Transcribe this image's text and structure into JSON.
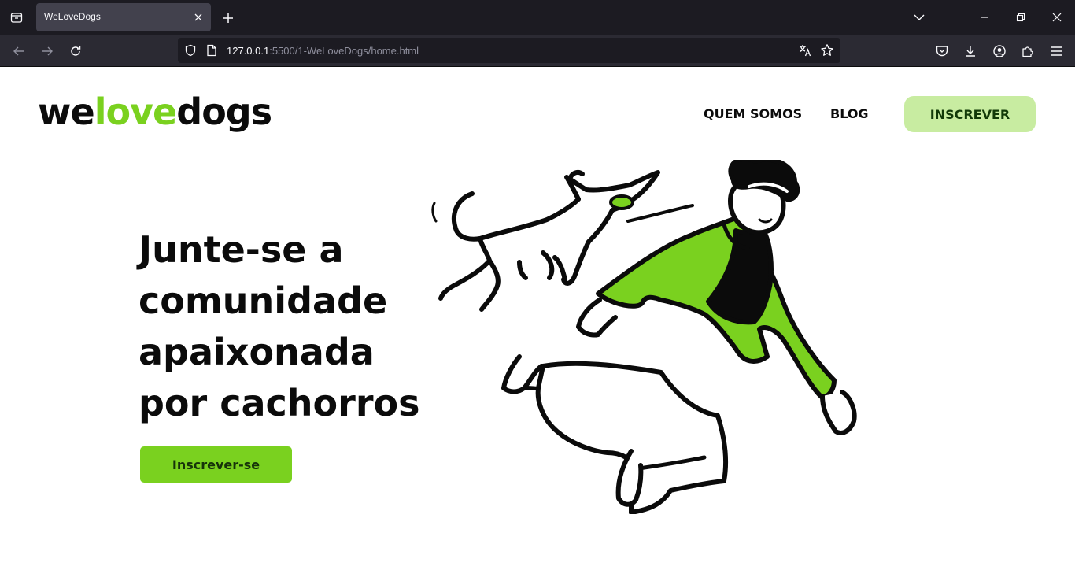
{
  "browser": {
    "tab_title": "WeLoveDogs",
    "url_host": "127.0.0.1",
    "url_rest": ":5500/1-WeLoveDogs/home.html"
  },
  "site": {
    "logo": {
      "part1": "we",
      "part2": "love",
      "part3": "dogs"
    },
    "nav": [
      {
        "label": "QUEM SOMOS"
      },
      {
        "label": "BLOG"
      }
    ],
    "signup_top_label": "INSCREVER",
    "hero": {
      "lines": [
        "Junte-se a",
        "comunidade",
        "apaixonada",
        "por cachorros"
      ],
      "button_label": "Inscrever-se"
    }
  },
  "colors": {
    "accent": "#7ad11f",
    "accent_light": "#c8eca1",
    "text": "#0b0b0b",
    "chrome_dark": "#1c1b22",
    "chrome_mid": "#2b2a33"
  }
}
